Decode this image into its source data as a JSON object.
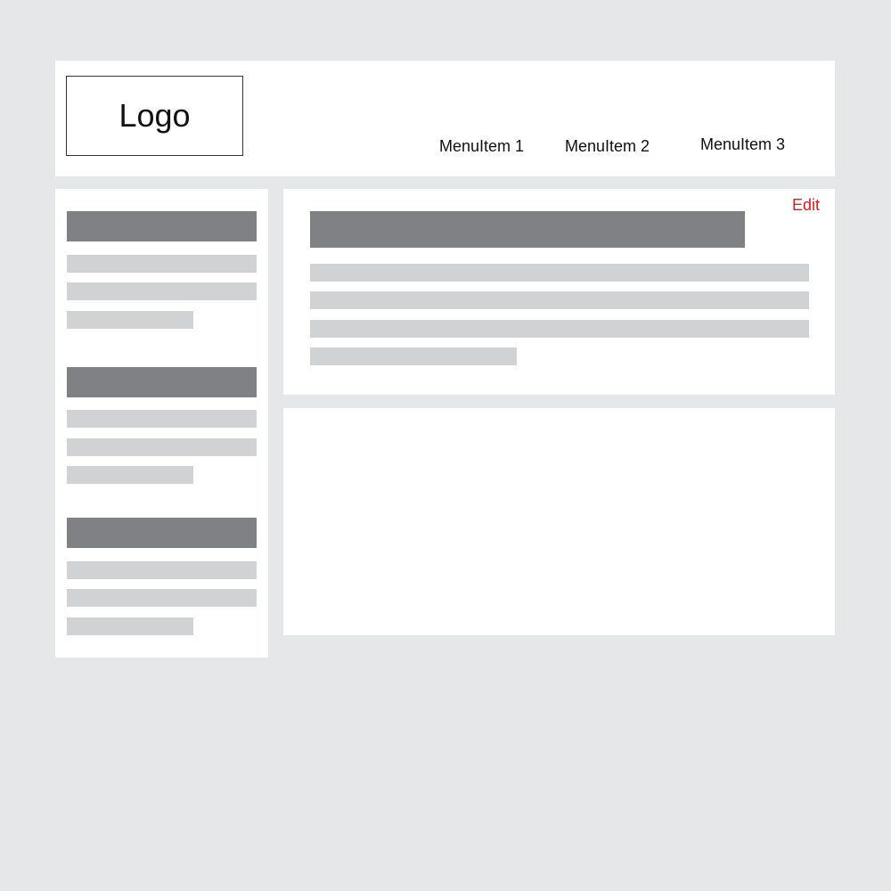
{
  "theme": {
    "background": "#e6e7e9",
    "panel": "#ffffff",
    "heading_bar": "#808184",
    "text_bar": "#d1d2d4",
    "accent": "#e4161f"
  },
  "header": {
    "logo_text": "Logo",
    "menu": [
      {
        "label": "MenuItem 1"
      },
      {
        "label": "MenuItem 2"
      },
      {
        "label": "MenuItem 3"
      }
    ]
  },
  "content": {
    "edit_label": "Edit"
  }
}
